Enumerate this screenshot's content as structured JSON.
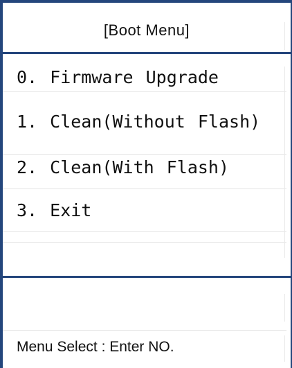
{
  "title": "[Boot Menu]",
  "menu": {
    "items": [
      {
        "label": "0. Firmware Upgrade"
      },
      {
        "label": "1. Clean(Without Flash)"
      },
      {
        "label": "2. Clean(With Flash)"
      },
      {
        "label": "3. Exit"
      }
    ]
  },
  "footer": {
    "prompt": "Menu Select : Enter NO."
  }
}
